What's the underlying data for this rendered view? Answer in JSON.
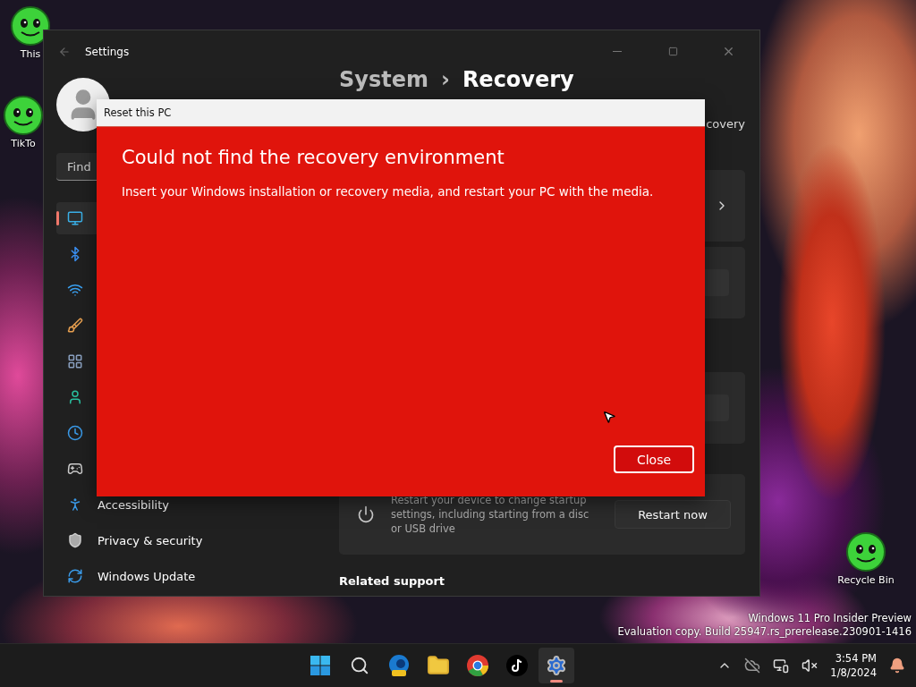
{
  "desktop": {
    "icons": [
      {
        "label": "This"
      },
      {
        "label": "TikTo"
      },
      {
        "label": "Recycle Bin"
      }
    ]
  },
  "settings": {
    "title": "Settings",
    "search": {
      "placeholder": "Find"
    },
    "breadcrumb": {
      "parent": "System",
      "separator": "›",
      "current": "Recovery"
    },
    "subtitle": "covery",
    "nav": [
      {
        "selected": true
      },
      {
        "selected": false
      },
      {
        "selected": false
      },
      {
        "selected": false
      },
      {
        "selected": false
      },
      {
        "selected": false
      },
      {
        "selected": false
      },
      {
        "selected": false
      },
      {
        "label": "Accessibility",
        "selected": false
      },
      {
        "label": "Privacy & security",
        "selected": false
      },
      {
        "label": "Windows Update",
        "selected": false
      }
    ],
    "restart_card": {
      "description": "Restart your device to change startup settings, including starting from a disc or USB drive",
      "button": "Restart now"
    },
    "related": "Related support"
  },
  "dialog": {
    "title": "Reset this PC",
    "heading": "Could not find the recovery environment",
    "message": "Insert your Windows installation or recovery media, and restart your PC with the media.",
    "button": "Close"
  },
  "watermark": [
    "Windows 11 Pro Insider Preview",
    "Evaluation copy. Build 25947.rs_prerelease.230901-1416"
  ],
  "taskbar": {
    "apps": [
      {
        "kind": "start",
        "selected": false
      },
      {
        "kind": "search",
        "selected": false
      },
      {
        "kind": "edge",
        "selected": false
      },
      {
        "kind": "explorer",
        "selected": false
      },
      {
        "kind": "chrome",
        "selected": false
      },
      {
        "kind": "tiktok",
        "selected": false
      },
      {
        "kind": "settings",
        "selected": true
      }
    ],
    "time": "3:54 PM",
    "date": "1/8/2024"
  }
}
